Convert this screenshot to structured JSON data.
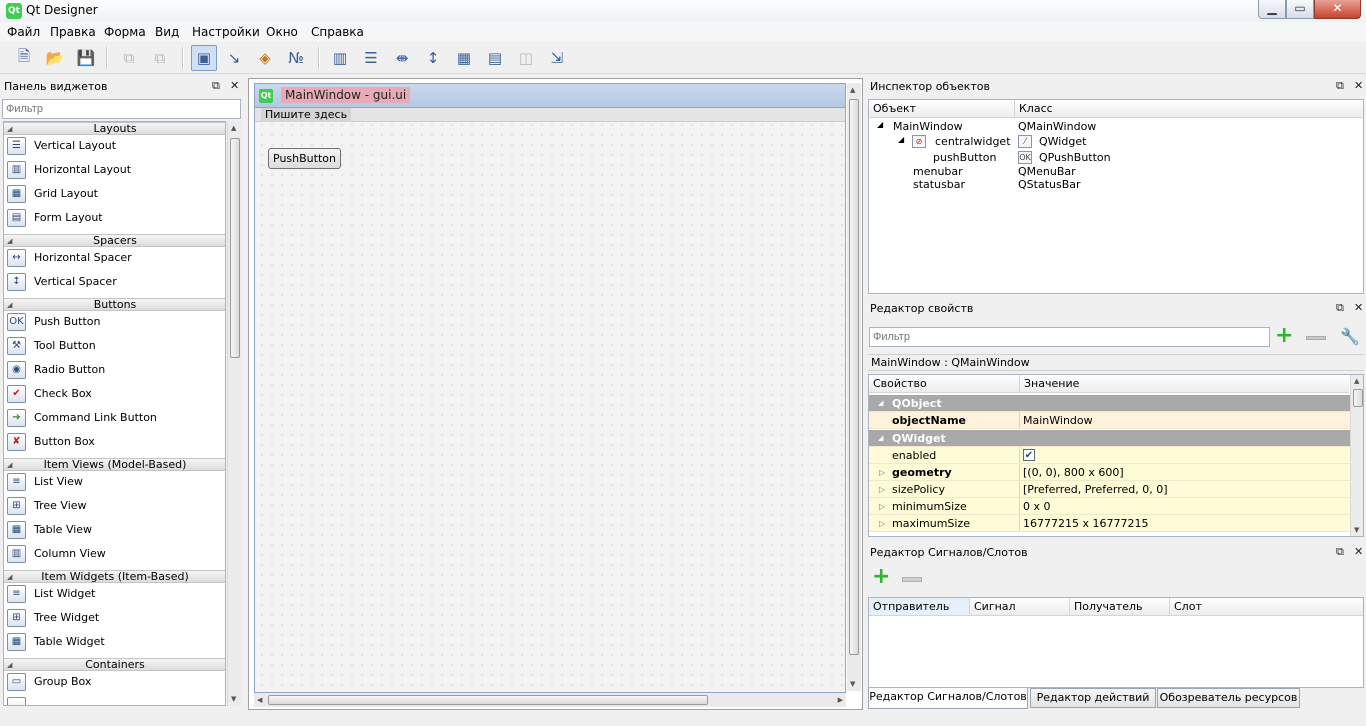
{
  "app": {
    "title": "Qt Designer",
    "logo": "Qt",
    "window_buttons": {
      "minimize": "▁",
      "maximize": "▭",
      "close": "✕"
    }
  },
  "menubar": [
    "Файл",
    "Правка",
    "Форма",
    "Вид",
    "Настройки",
    "Окно",
    "Справка"
  ],
  "toolbar": {
    "icons": [
      "new-file-icon",
      "open-file-icon",
      "save-icon",
      "copy-icon",
      "paste-icon",
      "edit-widgets-icon",
      "edit-signals-icon",
      "edit-buddies-icon",
      "edit-tab-order-icon",
      "layout-horizontal-icon",
      "layout-vertical-icon",
      "layout-horizontal-splitter-icon",
      "layout-vertical-splitter-icon",
      "layout-grid-icon",
      "layout-form-icon",
      "break-layout-icon",
      "adjust-size-icon"
    ]
  },
  "widget_box": {
    "title": "Панель виджетов",
    "filter_placeholder": "Фильтр",
    "float_icon": "⧉",
    "close_icon": "✕",
    "categories": [
      {
        "label": "Layouts",
        "items": [
          {
            "label": "Vertical Layout",
            "icon": "☰"
          },
          {
            "label": "Horizontal Layout",
            "icon": "▥"
          },
          {
            "label": "Grid Layout",
            "icon": "▦"
          },
          {
            "label": "Form Layout",
            "icon": "▤"
          }
        ]
      },
      {
        "label": "Spacers",
        "items": [
          {
            "label": "Horizontal Spacer",
            "icon": "↔"
          },
          {
            "label": "Vertical Spacer",
            "icon": "↕"
          }
        ]
      },
      {
        "label": "Buttons",
        "items": [
          {
            "label": "Push Button",
            "icon": "OK"
          },
          {
            "label": "Tool Button",
            "icon": "⚒"
          },
          {
            "label": "Radio Button",
            "icon": "◉"
          },
          {
            "label": "Check Box",
            "icon": "✔"
          },
          {
            "label": "Command Link Button",
            "icon": "➔"
          },
          {
            "label": "Button Box",
            "icon": "✘"
          }
        ]
      },
      {
        "label": "Item Views (Model-Based)",
        "items": [
          {
            "label": "List View",
            "icon": "≡"
          },
          {
            "label": "Tree View",
            "icon": "⊞"
          },
          {
            "label": "Table View",
            "icon": "▦"
          },
          {
            "label": "Column View",
            "icon": "▥"
          }
        ]
      },
      {
        "label": "Item Widgets (Item-Based)",
        "items": [
          {
            "label": "List Widget",
            "icon": "≡"
          },
          {
            "label": "Tree Widget",
            "icon": "⊞"
          },
          {
            "label": "Table Widget",
            "icon": "▦"
          }
        ]
      },
      {
        "label": "Containers",
        "items": [
          {
            "label": "Group Box",
            "icon": "▭"
          }
        ]
      }
    ]
  },
  "form_window": {
    "title": "MainWindow - gui.ui",
    "logo": "Qt",
    "menu_placeholder": "Пишите здесь",
    "push_button_text": "PushButton"
  },
  "object_inspector": {
    "title": "Инспектор объектов",
    "columns": [
      "Объект",
      "Класс"
    ],
    "rows": [
      {
        "object": "MainWindow",
        "class": "QMainWindow",
        "expander": "◢",
        "icon": ""
      },
      {
        "object": "centralwidget",
        "class": "QWidget",
        "expander": "◢",
        "icon": "⊘",
        "class_icon": "⁄"
      },
      {
        "object": "pushButton",
        "class": "QPushButton",
        "expander": "",
        "icon": "",
        "class_icon": "OK"
      },
      {
        "object": "menubar",
        "class": "QMenuBar",
        "expander": "",
        "icon": ""
      },
      {
        "object": "statusbar",
        "class": "QStatusBar",
        "expander": "",
        "icon": ""
      }
    ]
  },
  "property_editor": {
    "title": "Редактор свойств",
    "filter_placeholder": "Фильтр",
    "context": "MainWindow : QMainWindow",
    "columns": [
      "Свойство",
      "Значение"
    ],
    "rows": [
      {
        "type": "group",
        "name": "QObject",
        "value": ""
      },
      {
        "type": "bold",
        "name": "objectName",
        "value": "MainWindow",
        "bg": "peach"
      },
      {
        "type": "group",
        "name": "QWidget",
        "value": ""
      },
      {
        "type": "normal",
        "name": "enabled",
        "value": "✔",
        "bg": "yellow",
        "checkbox": true
      },
      {
        "type": "bold",
        "name": "geometry",
        "value": "[(0, 0), 800 x 600]",
        "bg": "yellow",
        "expandable": true
      },
      {
        "type": "normal",
        "name": "sizePolicy",
        "value": "[Preferred, Preferred, 0, 0]",
        "bg": "yellow",
        "expandable": true
      },
      {
        "type": "normal",
        "name": "minimumSize",
        "value": "0 x 0",
        "bg": "yellow",
        "expandable": true
      },
      {
        "type": "normal",
        "name": "maximumSize",
        "value": "16777215 x 16777215",
        "bg": "yellow",
        "expandable": true
      }
    ]
  },
  "signal_editor": {
    "title": "Редактор Сигналов/Слотов",
    "columns": [
      "Отправитель",
      "Сигнал",
      "Получатель",
      "Слот"
    ]
  },
  "bottom_tabs": [
    "Редактор Сигналов/Слотов",
    "Редактор действий",
    "Обозреватель ресурсов"
  ],
  "colors": {
    "accent": "#41cd52",
    "group_header": "#a9a9a9",
    "highlight_title": "#e8aab4"
  }
}
